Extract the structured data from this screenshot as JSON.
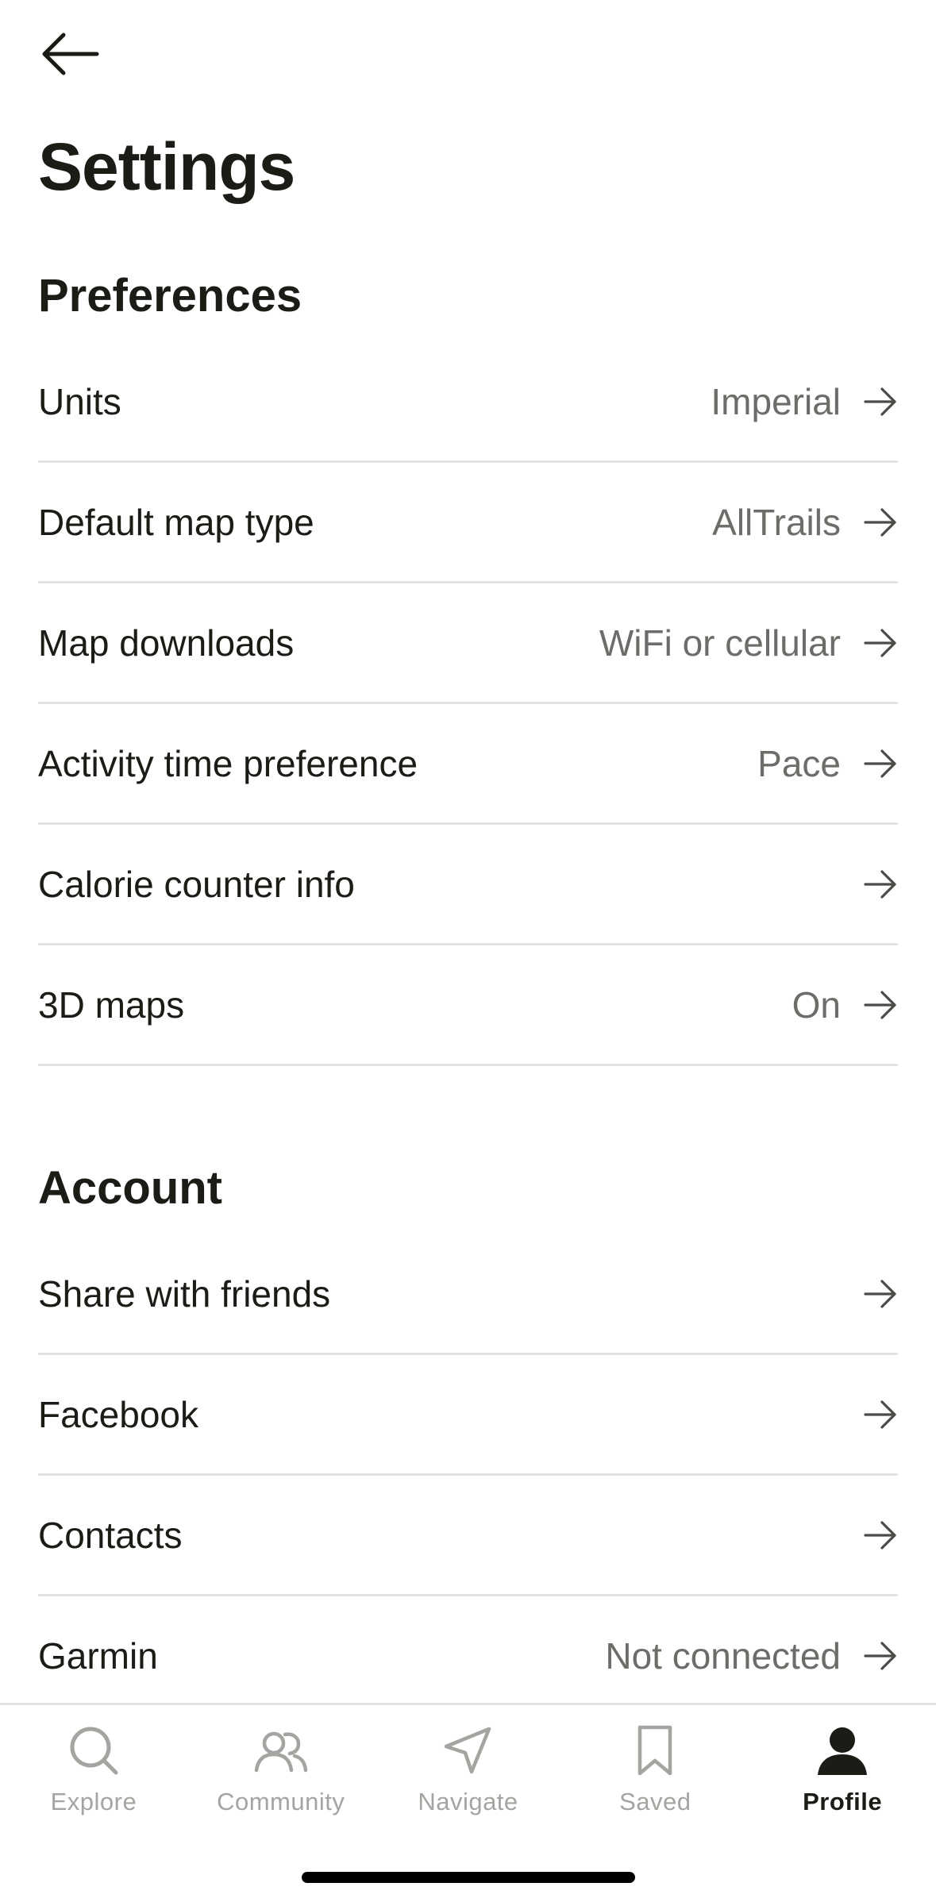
{
  "header": {
    "title": "Settings",
    "back_icon": "arrow-left-icon"
  },
  "preferences": {
    "title": "Preferences",
    "items": [
      {
        "label": "Units",
        "value": "Imperial"
      },
      {
        "label": "Default map type",
        "value": "AllTrails"
      },
      {
        "label": "Map downloads",
        "value": "WiFi or cellular"
      },
      {
        "label": "Activity time preference",
        "value": "Pace"
      },
      {
        "label": "Calorie counter info",
        "value": ""
      },
      {
        "label": "3D maps",
        "value": "On"
      }
    ]
  },
  "account": {
    "title": "Account",
    "items": [
      {
        "label": "Share with friends",
        "value": ""
      },
      {
        "label": "Facebook",
        "value": ""
      },
      {
        "label": "Contacts",
        "value": ""
      },
      {
        "label": "Garmin",
        "value": "Not connected"
      }
    ]
  },
  "nav": {
    "items": [
      {
        "label": "Explore",
        "icon": "search-icon",
        "active": false
      },
      {
        "label": "Community",
        "icon": "community-icon",
        "active": false
      },
      {
        "label": "Navigate",
        "icon": "navigate-icon",
        "active": false
      },
      {
        "label": "Saved",
        "icon": "bookmark-icon",
        "active": false
      },
      {
        "label": "Profile",
        "icon": "profile-icon",
        "active": true
      }
    ]
  },
  "colors": {
    "text_primary": "#1a1c16",
    "text_secondary": "#6b6d68",
    "nav_inactive": "#a3a5a0",
    "divider": "#e4e4e2"
  }
}
